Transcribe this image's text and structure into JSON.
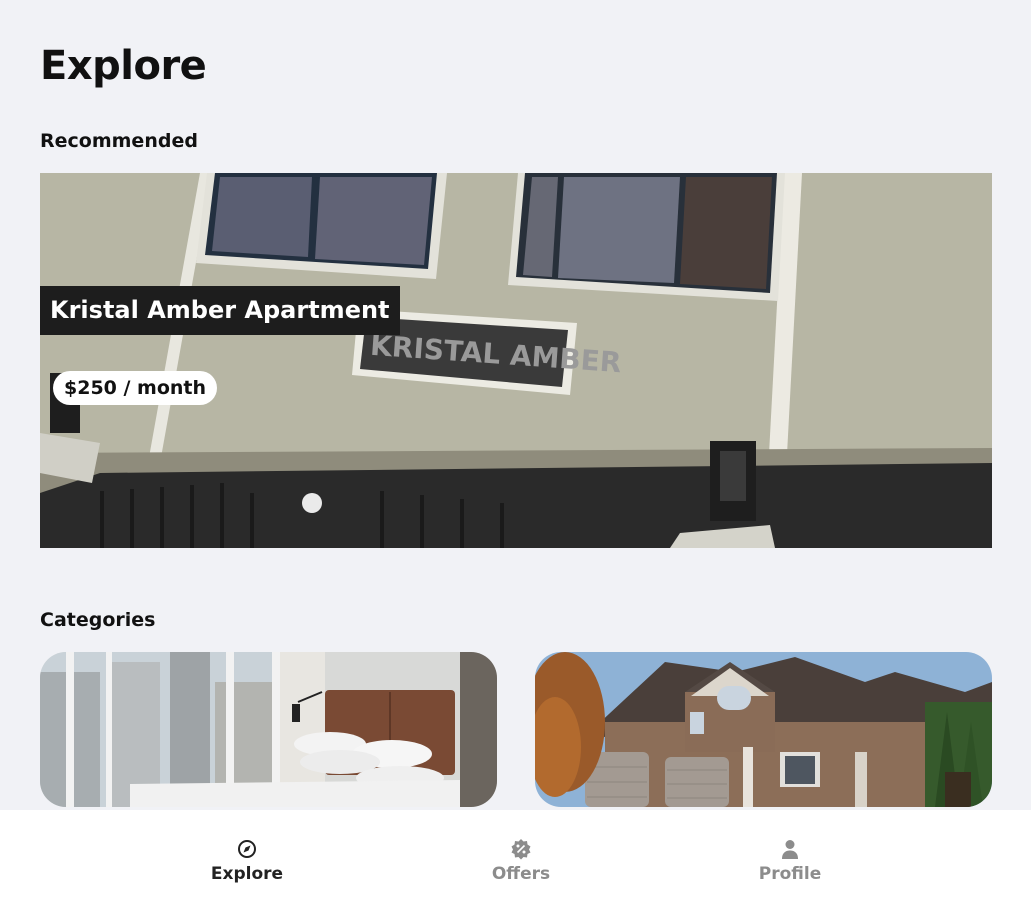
{
  "header": {
    "title": "Explore"
  },
  "recommended": {
    "heading": "Recommended",
    "listing": {
      "name": "Kristal Amber Apartment",
      "price": "$250 / month",
      "sign_text": "KRISTAL AMBER"
    }
  },
  "categories": {
    "heading": "Categories",
    "items": [
      {
        "image": "bedroom-photo"
      },
      {
        "image": "house-photo"
      }
    ]
  },
  "bottom_nav": {
    "items": [
      {
        "label": "Explore",
        "icon": "compass-icon",
        "active": true
      },
      {
        "label": "Offers",
        "icon": "discount-badge-icon",
        "active": false
      },
      {
        "label": "Profile",
        "icon": "person-icon",
        "active": false
      }
    ]
  },
  "colors": {
    "background": "#f1f2f6",
    "active_nav": "#222222",
    "inactive_nav": "#8c8c8c",
    "title_bg": "#1d1d1d"
  }
}
